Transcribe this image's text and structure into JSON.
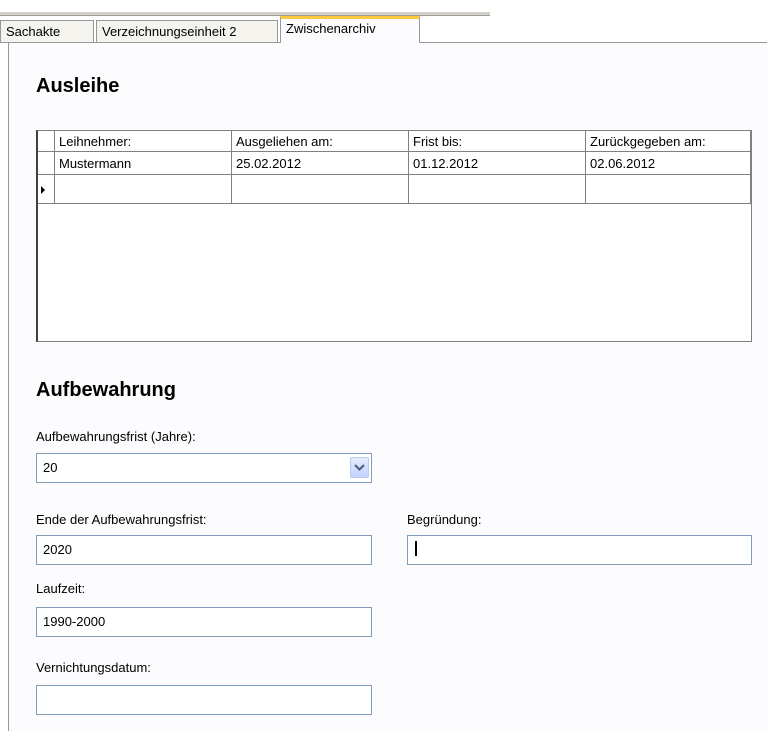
{
  "tabs": [
    {
      "label": "Sachakte",
      "active": false
    },
    {
      "label": "Verzeichnungseinheit 2",
      "active": false
    },
    {
      "label": "Zwischenarchiv",
      "active": true
    }
  ],
  "ausleihe": {
    "heading": "Ausleihe",
    "columns": [
      "Leihnehmer:",
      "Ausgeliehen am:",
      "Frist bis:",
      "Zurückgegeben am:"
    ],
    "rows": [
      [
        "Mustermann",
        "25.02.2012",
        "01.12.2012",
        "02.06.2012"
      ]
    ]
  },
  "aufbewahrung": {
    "heading": "Aufbewahrung",
    "frist_label": "Aufbewahrungsfrist (Jahre):",
    "frist_value": "20",
    "ende_label": "Ende der Aufbewahrungsfrist:",
    "ende_value": "2020",
    "begruendung_label": "Begründung:",
    "begruendung_value": "",
    "laufzeit_label": "Laufzeit:",
    "laufzeit_value": "1990-2000",
    "vernichtung_label": "Vernichtungsdatum:",
    "vernichtung_value": ""
  }
}
